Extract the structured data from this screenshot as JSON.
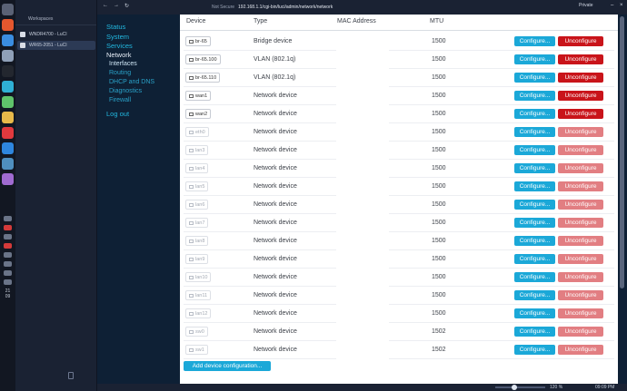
{
  "browser": {
    "panel_title": "Workspaces",
    "tabs": [
      {
        "label": "WNDR4700 - LuCI"
      },
      {
        "label": "WR65-2051 - LuCI"
      }
    ],
    "security_label": "Not Secure",
    "url": "192.168.1.1/cgi-bin/luci/admin/network/network",
    "profile_label": "Private",
    "zoom": "120 %",
    "clock": "09:09 PM"
  },
  "sidebar_clock": {
    "hour": "21",
    "minute": "09"
  },
  "luci_menu": {
    "items": [
      {
        "label": "Status"
      },
      {
        "label": "System"
      },
      {
        "label": "Services"
      },
      {
        "label": "Network"
      },
      {
        "label": "Log out"
      }
    ],
    "network_sub": [
      {
        "label": "Interfaces"
      },
      {
        "label": "Routing"
      },
      {
        "label": "DHCP and DNS"
      },
      {
        "label": "Diagnostics"
      },
      {
        "label": "Firewall"
      }
    ]
  },
  "table": {
    "headers": {
      "device": "Device",
      "type": "Type",
      "mac": "MAC Address",
      "mtu": "MTU"
    },
    "configure_label": "Configure...",
    "unconfigure_label": "Unconfigure",
    "rows": [
      {
        "device": "br-65",
        "type": "Bridge device",
        "mtu": "1500",
        "dim": false
      },
      {
        "device": "br-65.100",
        "type": "VLAN (802.1q)",
        "mtu": "1500",
        "dim": false
      },
      {
        "device": "br-65.110",
        "type": "VLAN (802.1q)",
        "mtu": "1500",
        "dim": false
      },
      {
        "device": "wan1",
        "type": "Network device",
        "mtu": "1500",
        "dim": false
      },
      {
        "device": "wan2",
        "type": "Network device",
        "mtu": "1500",
        "dim": false
      },
      {
        "device": "eth0",
        "type": "Network device",
        "mtu": "1500",
        "dim": true
      },
      {
        "device": "lan3",
        "type": "Network device",
        "mtu": "1500",
        "dim": true
      },
      {
        "device": "lan4",
        "type": "Network device",
        "mtu": "1500",
        "dim": true
      },
      {
        "device": "lan5",
        "type": "Network device",
        "mtu": "1500",
        "dim": true
      },
      {
        "device": "lan6",
        "type": "Network device",
        "mtu": "1500",
        "dim": true
      },
      {
        "device": "lan7",
        "type": "Network device",
        "mtu": "1500",
        "dim": true
      },
      {
        "device": "lan8",
        "type": "Network device",
        "mtu": "1500",
        "dim": true
      },
      {
        "device": "lan9",
        "type": "Network device",
        "mtu": "1500",
        "dim": true
      },
      {
        "device": "lan10",
        "type": "Network device",
        "mtu": "1500",
        "dim": true
      },
      {
        "device": "lan11",
        "type": "Network device",
        "mtu": "1500",
        "dim": true
      },
      {
        "device": "lan12",
        "type": "Network device",
        "mtu": "1500",
        "dim": true
      },
      {
        "device": "sw0",
        "type": "Network device",
        "mtu": "1502",
        "dim": true
      },
      {
        "device": "sw1",
        "type": "Network device",
        "mtu": "1502",
        "dim": true
      }
    ],
    "add_label": "Add device configuration..."
  },
  "colors": {
    "configure": "#1ba8d8",
    "unconfigure": "#c9141a",
    "unconfigure_dim": "#e27e82",
    "menu_bg": "#0e2035",
    "menu_link": "#22b8e0"
  }
}
